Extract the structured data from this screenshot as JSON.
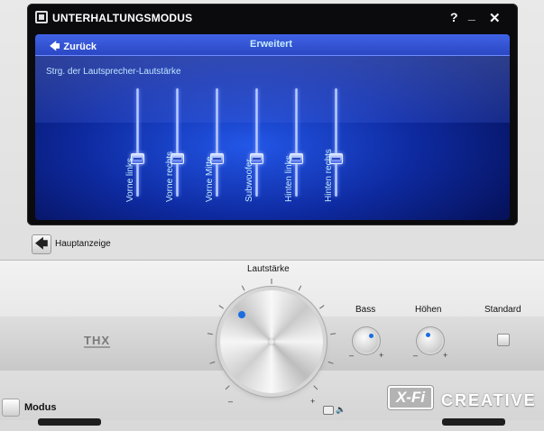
{
  "window": {
    "title": "UNTERHALTUNGSMODUS",
    "help_label": "?",
    "minimize_label": "_",
    "close_label": "✕"
  },
  "panel": {
    "back_label": "Zurück",
    "tab_label": "Erweitert",
    "subtitle": "Strg. der Lautsprecher-Lautstärke",
    "sliders": [
      {
        "label": "Vorne links",
        "level": 0.5
      },
      {
        "label": "Vorne rechts",
        "level": 0.5
      },
      {
        "label": "Vorne Mitte",
        "level": 0.5
      },
      {
        "label": "Subwoofer",
        "level": 0.5
      },
      {
        "label": "Hinten links",
        "level": 0.5
      },
      {
        "label": "Hinten rechts",
        "level": 0.5
      }
    ]
  },
  "home": {
    "label": "Hauptanzeige"
  },
  "console": {
    "volume_label": "Lautstärke",
    "volume_minus": "–",
    "volume_plus": "+",
    "bass_label": "Bass",
    "treble_label": "Höhen",
    "standard_label": "Standard",
    "knob_minus": "–",
    "knob_plus": "+",
    "mode_label": "Modus",
    "thx_logo": "THX",
    "xfi_logo": "X-Fi",
    "brand_logo": "CREATIVE"
  },
  "colors": {
    "accent": "#1b6de0",
    "panel_blue": "#0e2aa0",
    "panel_text": "#c6ecff"
  }
}
